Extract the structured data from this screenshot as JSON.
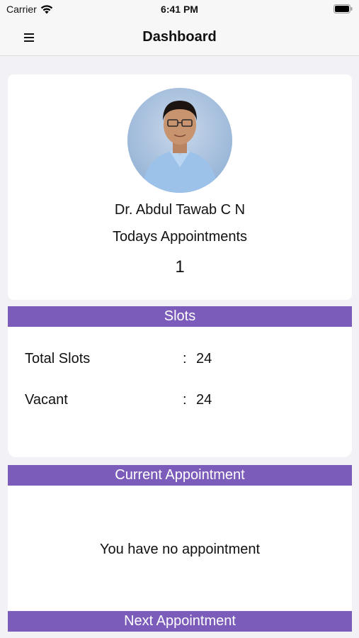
{
  "status_bar": {
    "carrier": "Carrier",
    "time": "6:41 PM"
  },
  "nav": {
    "title": "Dashboard",
    "menu_icon": "hamburger-menu-icon"
  },
  "profile": {
    "doctor_name": "Dr. Abdul Tawab C N",
    "appointments_label": "Todays Appointments",
    "appointments_count": "1"
  },
  "slots": {
    "header": "Slots",
    "rows": [
      {
        "label": "Total Slots",
        "separator": ":",
        "value": "24"
      },
      {
        "label": "Vacant",
        "separator": ":",
        "value": "24"
      }
    ]
  },
  "current_appointment": {
    "header": "Current Appointment",
    "message": "You have no appointment"
  },
  "next_appointment": {
    "header": "Next Appointment"
  },
  "colors": {
    "accent": "#7b5cba",
    "background": "#f2f1f6",
    "card": "#ffffff"
  }
}
